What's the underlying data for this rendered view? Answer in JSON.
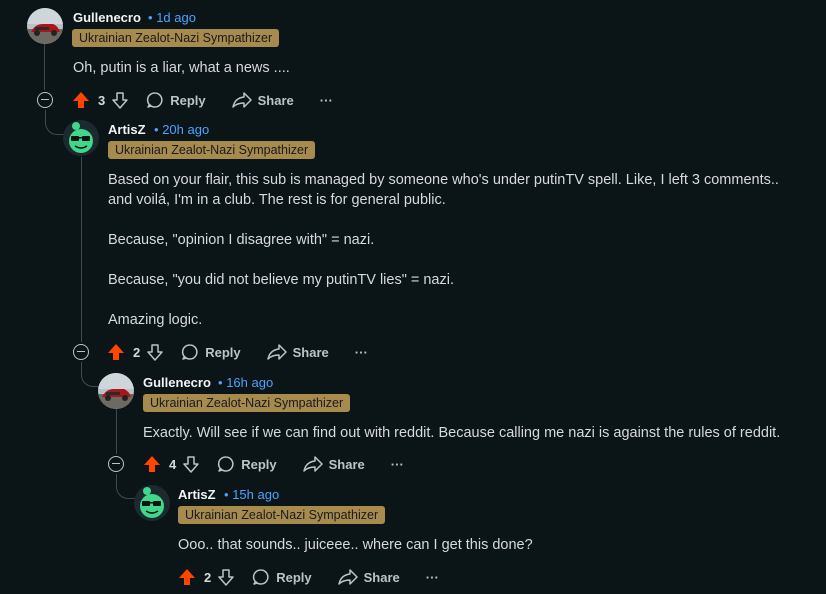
{
  "comments": [
    {
      "author": "Gullenecro",
      "time": "1d ago",
      "flair": "Ukrainian Zealot-Nazi Sympathizer",
      "body": [
        "Oh, putin is a liar, what a news ...."
      ],
      "score": "3",
      "reply_label": "Reply",
      "share_label": "Share",
      "avatar": "car-photo-avatar"
    },
    {
      "author": "ArtisZ",
      "time": "20h ago",
      "flair": "Ukrainian Zealot-Nazi Sympathizer",
      "body": [
        "Based on your flair, this sub is managed by someone who's under putinTV spell. Like, I left 3 comments..",
        "and voilá, I'm in a club. The rest is for general public.",
        "Because, \"opinion I disagree with\" = nazi.",
        "Because, \"you did not believe my putinTV lies\" = nazi.",
        "Amazing logic."
      ],
      "score": "2",
      "reply_label": "Reply",
      "share_label": "Share",
      "avatar": "green-snoo-sunglasses-avatar"
    },
    {
      "author": "Gullenecro",
      "time": "16h ago",
      "flair": "Ukrainian Zealot-Nazi Sympathizer",
      "body": [
        "Exactly. Will see if we can find out with reddit. Because calling me nazi is against the rules of reddit."
      ],
      "score": "4",
      "reply_label": "Reply",
      "share_label": "Share",
      "avatar": "car-photo-avatar"
    },
    {
      "author": "ArtisZ",
      "time": "15h ago",
      "flair": "Ukrainian Zealot-Nazi Sympathizer",
      "body": [
        "Ooo.. that sounds.. juiceee.. where can I get this done?"
      ],
      "score": "2",
      "reply_label": "Reply",
      "share_label": "Share",
      "avatar": "green-snoo-sunglasses-avatar"
    }
  ],
  "meta_separator": "•",
  "more_label": "···",
  "colors": {
    "background": "#0b1416",
    "upvote": "#ff4500",
    "flair_bg": "#a68a4e",
    "time": "#4da3ff"
  }
}
